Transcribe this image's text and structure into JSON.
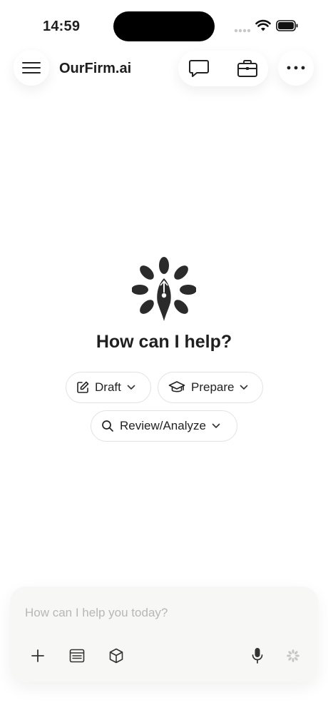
{
  "status_bar": {
    "time": "14:59"
  },
  "header": {
    "brand": "OurFirm.ai"
  },
  "icons": {
    "menu": "hamburger-menu-icon",
    "chat": "chat-bubble-icon",
    "briefcase": "briefcase-icon",
    "more": "more-horizontal-icon",
    "logo": "pen-nib-flower-logo"
  },
  "main": {
    "headline": "How can I help?",
    "chips": [
      {
        "label": "Draft",
        "icon": "edit-icon"
      },
      {
        "label": "Prepare",
        "icon": "graduation-cap-icon"
      },
      {
        "label": "Review/Analyze",
        "icon": "search-icon"
      }
    ]
  },
  "composer": {
    "placeholder": "How can I help you today?",
    "value": ""
  }
}
